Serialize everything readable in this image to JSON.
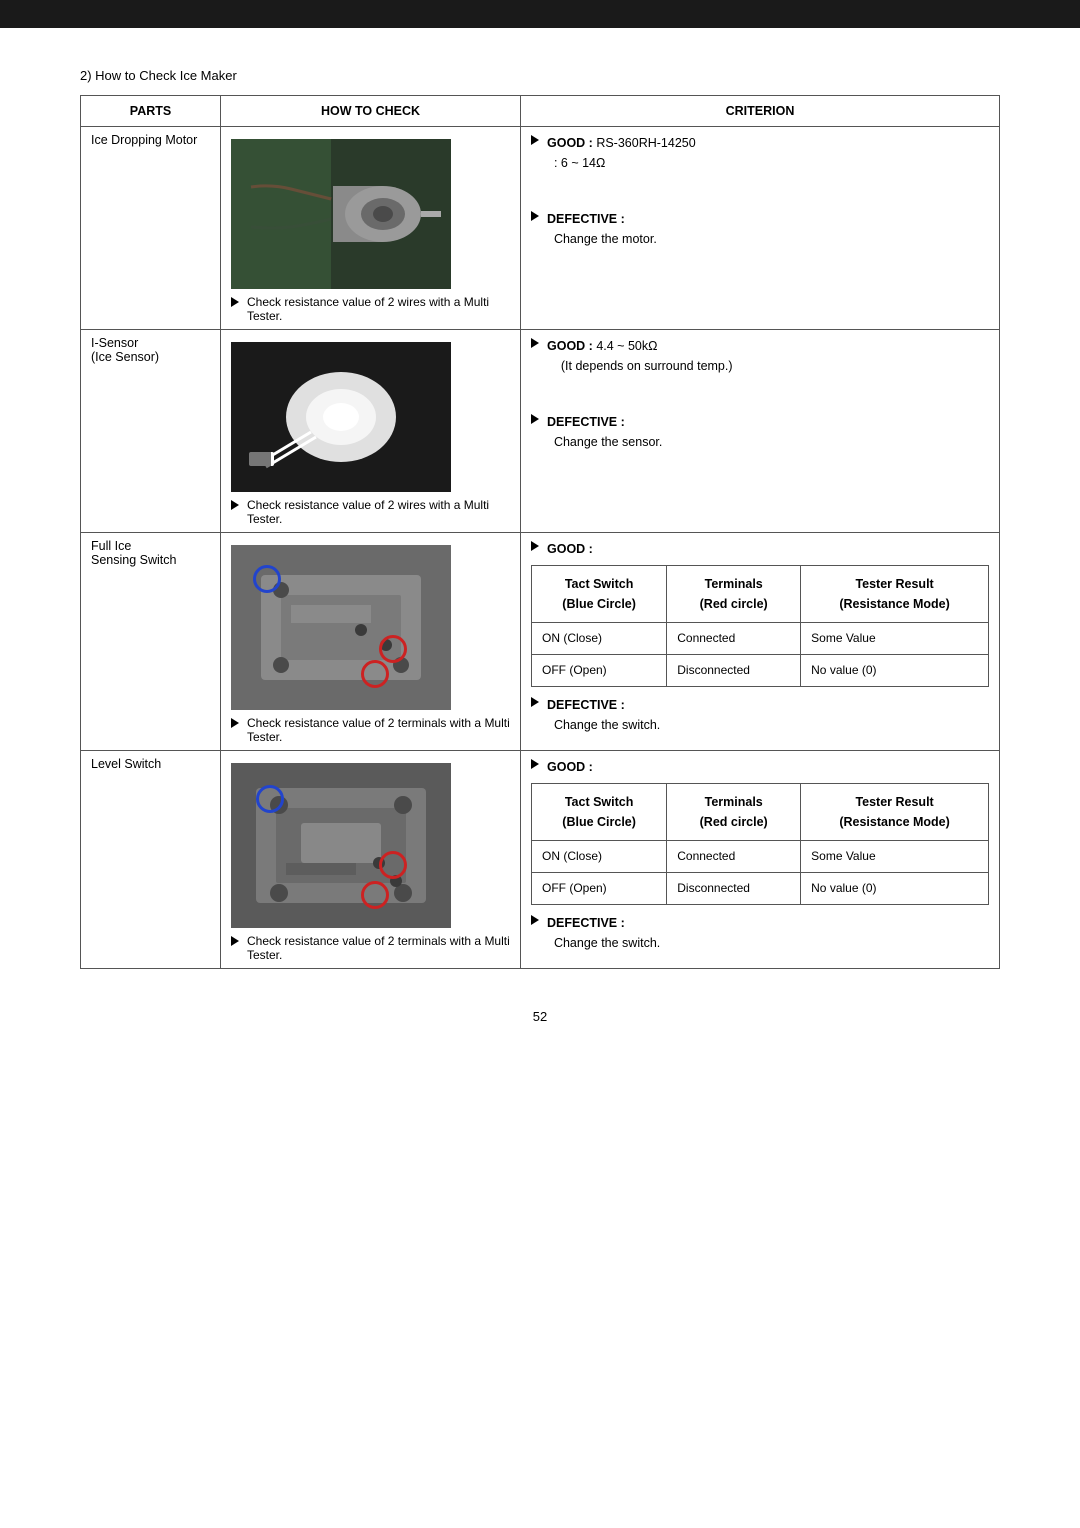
{
  "page": {
    "section_title": "2) How to Check Ice Maker",
    "page_number": "52",
    "table": {
      "headers": {
        "parts": "PARTS",
        "how_to_check": "HOW TO CHECK",
        "criterion": "CRITERION"
      },
      "rows": [
        {
          "id": "ice-dropping-motor",
          "part_name": "Ice Dropping Motor",
          "how_to_check_note": "Check resistance value of 2 wires with a Multi Tester.",
          "criterion_good_label": "GOOD :",
          "criterion_good_value": "RS-360RH-14250\n: 6 ~ 14Ω",
          "criterion_defective_label": "DEFECTIVE :",
          "criterion_defective_value": "Change the motor."
        },
        {
          "id": "i-sensor",
          "part_name": "I-Sensor\n(Ice Sensor)",
          "how_to_check_note": "Check resistance value of 2 wires with a Multi Tester.",
          "criterion_good_label": "GOOD :",
          "criterion_good_value": "4.4 ~ 50kΩ\n(It depends on surround temp.)",
          "criterion_defective_label": "DEFECTIVE :",
          "criterion_defective_value": "Change the sensor."
        },
        {
          "id": "full-ice-sensing-switch",
          "part_name": "Full Ice\nSensing Switch",
          "how_to_check_note": "Check resistance value of 2 terminals with a Multi Tester.",
          "criterion_good_label": "GOOD :",
          "inner_table_headers": [
            "Tact Switch\n(Blue Circle)",
            "Terminals\n(Red circle)",
            "Tester Result\n(Resistance Mode)"
          ],
          "inner_table_rows": [
            [
              "ON (Close)",
              "Connected",
              "Some Value"
            ],
            [
              "OFF (Open)",
              "Disconnected",
              "No value (0)"
            ]
          ],
          "criterion_defective_label": "DEFECTIVE :",
          "criterion_defective_value": "Change the switch."
        },
        {
          "id": "level-switch",
          "part_name": "Level Switch",
          "how_to_check_note": "Check resistance value of 2 terminals with a Multi Tester.",
          "criterion_good_label": "GOOD :",
          "inner_table_headers": [
            "Tact Switch\n(Blue Circle)",
            "Terminals\n(Red circle)",
            "Tester Result\n(Resistance Mode)"
          ],
          "inner_table_rows": [
            [
              "ON (Close)",
              "Connected",
              "Some Value"
            ],
            [
              "OFF (Open)",
              "Disconnected",
              "No value (0)"
            ]
          ],
          "criterion_defective_label": "DEFECTIVE :",
          "criterion_defective_value": "Change the switch."
        }
      ]
    }
  }
}
